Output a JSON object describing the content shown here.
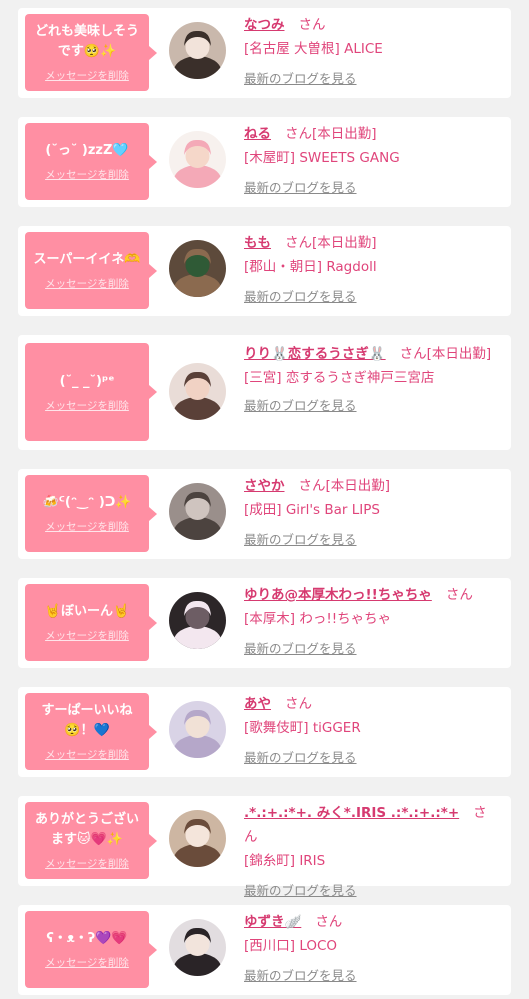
{
  "colors": {
    "bubble": "#ff8fa3",
    "name": "#d63a70",
    "shop": "#e0457b",
    "link_gray": "#8a8a8a",
    "background": "#f1f1f1"
  },
  "entries": [
    {
      "message": "どれも美味しそうです🥺✨",
      "delete_label": "メッセージを削除",
      "name": "なつみ",
      "honorific": "さん",
      "status": "",
      "shop": "[名古屋 大曽根] ALICE",
      "blog_link": "最新のブログを見る",
      "avatar": "photo-avatar"
    },
    {
      "message": "(˘っ˘ )zzZ🩵",
      "delete_label": "メッセージを削除",
      "name": "ねる",
      "honorific": "さん",
      "status": "[本日出勤]",
      "shop": "[木屋町] SWEETS GANG",
      "blog_link": "最新のブログを見る",
      "avatar": "photo-avatar"
    },
    {
      "message": "スーパーイイネ🫶",
      "delete_label": "メッセージを削除",
      "name": "もも",
      "honorific": "さん",
      "status": "[本日出勤]",
      "shop": "[郡山・朝日] Ragdoll",
      "blog_link": "最新のブログを見る",
      "avatar": "photo-avatar"
    },
    {
      "message": "(˘_ _˘)ᵖᵉ",
      "delete_label": "メッセージを削除",
      "name": "りり🐰恋するうさぎ🐰",
      "honorific": "さん",
      "status": "[本日出勤]",
      "shop": "[三宮] 恋するうさぎ神戸三宮店",
      "blog_link": "最新のブログを見る",
      "avatar": "photo-avatar"
    },
    {
      "message": "🍻ᑦ(ᵔ‿ᵔ )ᑐ✨",
      "delete_label": "メッセージを削除",
      "name": "さやか",
      "honorific": "さん",
      "status": "[本日出勤]",
      "shop": "[成田] Girl's Bar LIPS",
      "blog_link": "最新のブログを見る",
      "avatar": "photo-avatar"
    },
    {
      "message": "🤘ぼいーん🤘",
      "delete_label": "メッセージを削除",
      "name": "ゆりあ@本厚木わっ!!ちゃちゃ",
      "honorific": "さん",
      "status": "",
      "shop": "[本厚木] わっ!!ちゃちゃ",
      "blog_link": "最新のブログを見る",
      "avatar": "photo-avatar"
    },
    {
      "message": "すーぱーいいね🥺！💙",
      "delete_label": "メッセージを削除",
      "name": "あや",
      "honorific": "さん",
      "status": "",
      "shop": "[歌舞伎町] tiGGER",
      "blog_link": "最新のブログを見る",
      "avatar": "photo-avatar"
    },
    {
      "message": "ありがとうございます🐱💗✨",
      "delete_label": "メッセージを削除",
      "name": ".*.:+.:*+. みく*.IRIS .:*.:+.:*+",
      "honorific": "さん",
      "status": "",
      "shop": "[錦糸町] IRIS",
      "blog_link": "最新のブログを見る",
      "avatar": "photo-avatar"
    },
    {
      "message": "ʕ・ᴥ・ʔ💜💗",
      "delete_label": "メッセージを削除",
      "name": "ゆずき🪽",
      "honorific": "さん",
      "status": "",
      "shop": "[西川口] LOCO",
      "blog_link": "最新のブログを見る",
      "avatar": "photo-avatar"
    }
  ]
}
